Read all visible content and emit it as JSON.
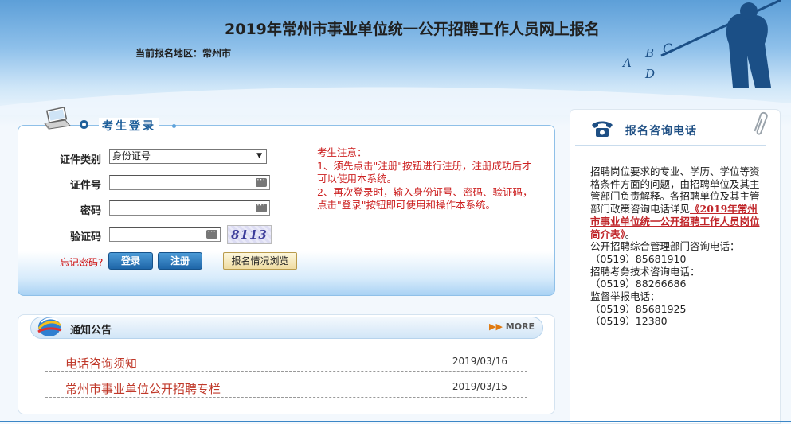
{
  "header": {
    "title": "2019年常州市事业单位统一公开招聘工作人员网上报名",
    "region_label": "当前报名地区：",
    "region_value": "常州市",
    "decor_letters": [
      "A",
      "B",
      "C",
      "D"
    ]
  },
  "login": {
    "title": "考生登录",
    "id_type_label": "证件类别",
    "id_type_value": "身份证号",
    "id_number_label": "证件号",
    "password_label": "密码",
    "captcha_label": "验证码",
    "captcha_text": "8113",
    "forgot_password": "忘记密码?",
    "login_button": "登录",
    "register_button": "注册",
    "browse_button": "报名情况浏览"
  },
  "notice": {
    "title": "考生注意：",
    "line1": "1、须先点击\"注册\"按钮进行注册，注册成功后才可以使用本系统。",
    "line2": "2、再次登录时，输入身份证号、密码、验证码，点击\"登录\"按钮即可使用和操作本系统。"
  },
  "announcements": {
    "title": "通知公告",
    "more_label": "MORE",
    "items": [
      {
        "title": "电话咨询须知",
        "date": "2019/03/16"
      },
      {
        "title": "常州市事业单位公开招聘专栏",
        "date": "2019/03/15"
      }
    ]
  },
  "consult": {
    "title": "报名咨询电话",
    "intro": "招聘岗位要求的专业、学历、学位等资格条件方面的问题，由招聘单位及其主管部门负责解释。各招聘单位及其主管部门政策咨询电话详见",
    "link_text": "《2019年常州市事业单位统一公开招聘工作人员岗位简介表》",
    "intro_end": "。",
    "admin_label": "公开招聘综合管理部门咨询电话：",
    "admin_phone": "（0519）85681910",
    "tech_label": "招聘考务技术咨询电话：",
    "tech_phone": "（0519）88266686",
    "supervise_label": "监督举报电话：",
    "supervise_phone1": "（0519）85681925",
    "supervise_phone2": "（0519）12380"
  },
  "colors": {
    "brand_blue": "#1e5f9a",
    "notice_red": "#cc2020",
    "link_red": "#c0262a"
  }
}
